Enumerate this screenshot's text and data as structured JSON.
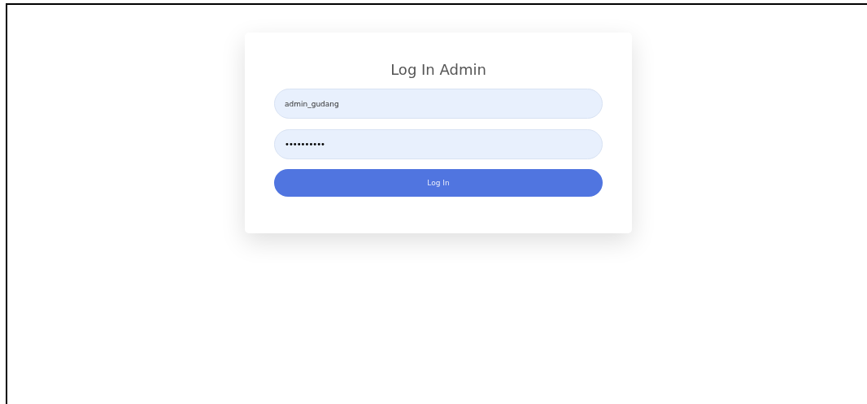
{
  "login_card": {
    "title": "Log In Admin",
    "fields": [
      {
        "kind": "text",
        "value": "admin_gudang"
      },
      {
        "kind": "password",
        "value": "••••••••••"
      }
    ],
    "button": {
      "label": "Log In"
    }
  }
}
